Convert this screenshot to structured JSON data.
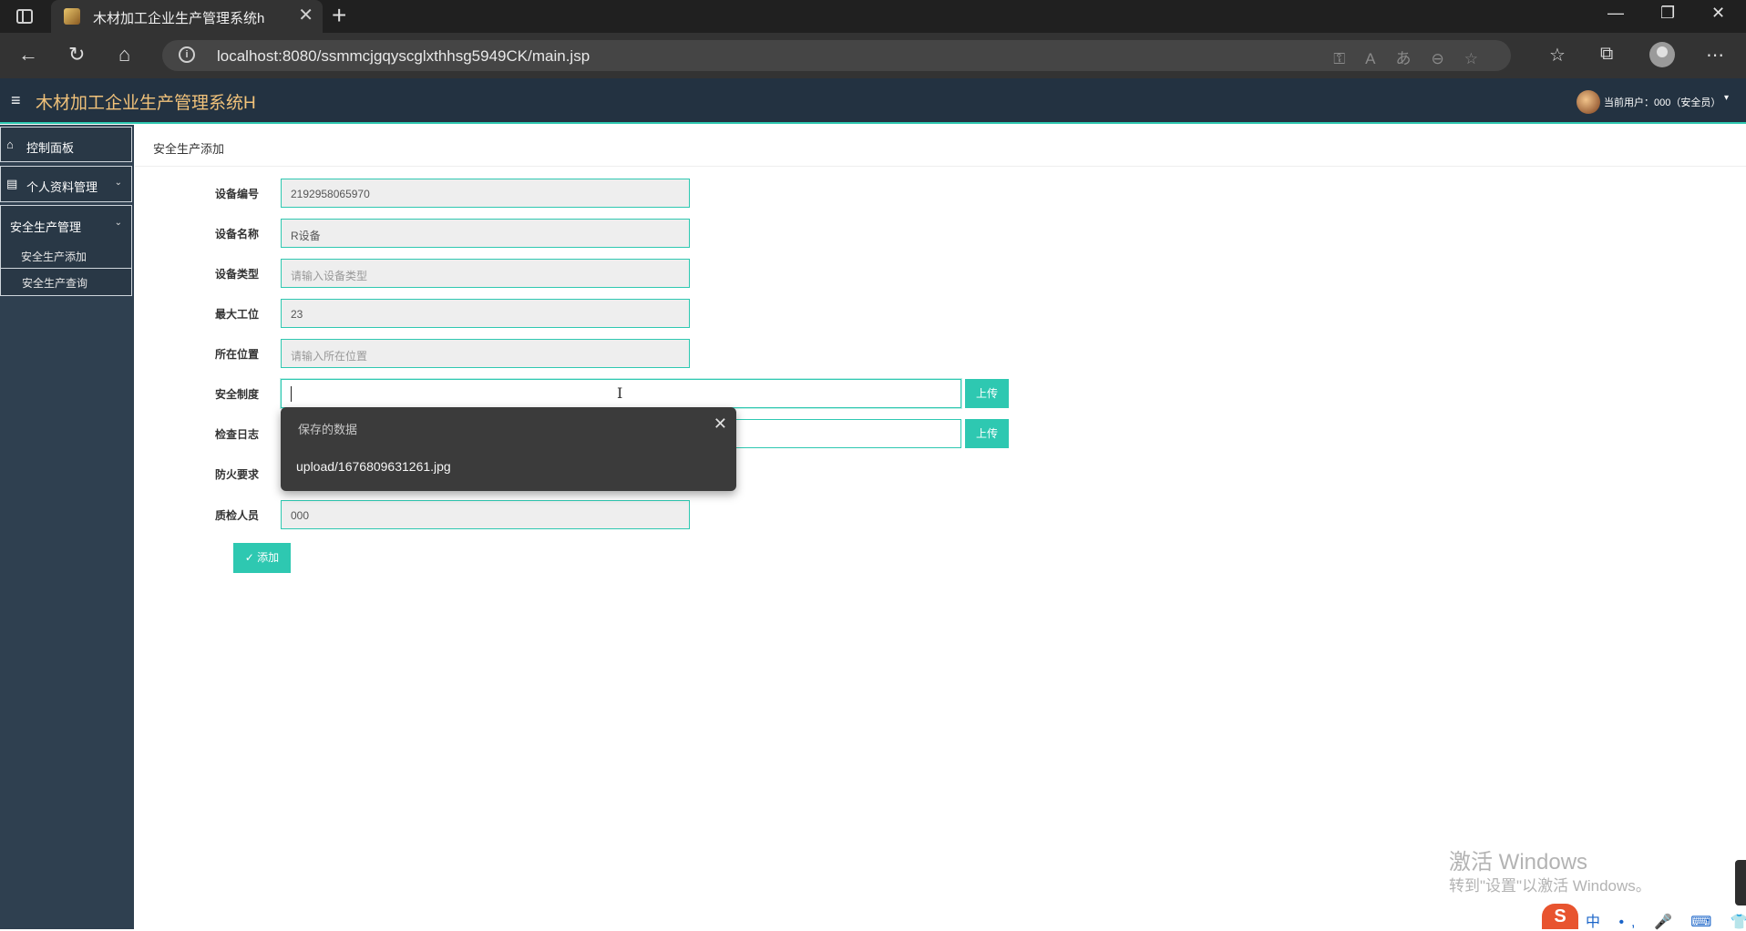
{
  "browser": {
    "tab_title": "木材加工企业生产管理系统h",
    "tab_close": "✕",
    "new_tab": "+",
    "url": "localhost:8080/ssmmcjgqyscglxthhsg5949CK/main.jsp",
    "info_icon": "i",
    "window_controls": {
      "minimize": "—",
      "restore": "❐",
      "close": "✕"
    }
  },
  "app": {
    "title": "木材加工企业生产管理系统H",
    "hamburger": "≡",
    "user_label": "当前用户：000（安全员）",
    "user_caret": "▾"
  },
  "sidebar": {
    "items": [
      {
        "label": "控制面板",
        "icon": "home-icon"
      },
      {
        "label": "个人资料管理",
        "icon": "document-icon",
        "chevron": "⌄"
      },
      {
        "label": "安全生产管理",
        "chevron": "⌄"
      }
    ],
    "sub_items": [
      {
        "label": "安全生产添加"
      },
      {
        "label": "安全生产查询"
      }
    ]
  },
  "main": {
    "breadcrumb": "安全生产添加",
    "fields": [
      {
        "label": "设备编号",
        "value": "2192958065970",
        "placeholder": ""
      },
      {
        "label": "设备名称",
        "value": "R设备",
        "placeholder": ""
      },
      {
        "label": "设备类型",
        "value": "",
        "placeholder": "请输入设备类型"
      },
      {
        "label": "最大工位",
        "value": "23",
        "placeholder": ""
      },
      {
        "label": "所在位置",
        "value": "",
        "placeholder": "请输入所在位置"
      },
      {
        "label": "安全制度",
        "value": "",
        "placeholder": ""
      },
      {
        "label": "检查日志",
        "value": "",
        "placeholder": ""
      },
      {
        "label": "防火要求",
        "value": "",
        "placeholder": ""
      },
      {
        "label": "质检人员",
        "value": "000",
        "placeholder": ""
      }
    ],
    "upload_label": "上传",
    "add_button": "✓ 添加"
  },
  "autocomplete": {
    "title": "保存的数据",
    "close": "✕",
    "item": "upload/1676809631261.jpg"
  },
  "watermark": {
    "line1": "激活 Windows",
    "line2": "转到\"设置\"以激活 Windows。"
  },
  "ime": {
    "logo": "S",
    "text": "中 •, 🎤 ⌨ 👕 ▦"
  }
}
